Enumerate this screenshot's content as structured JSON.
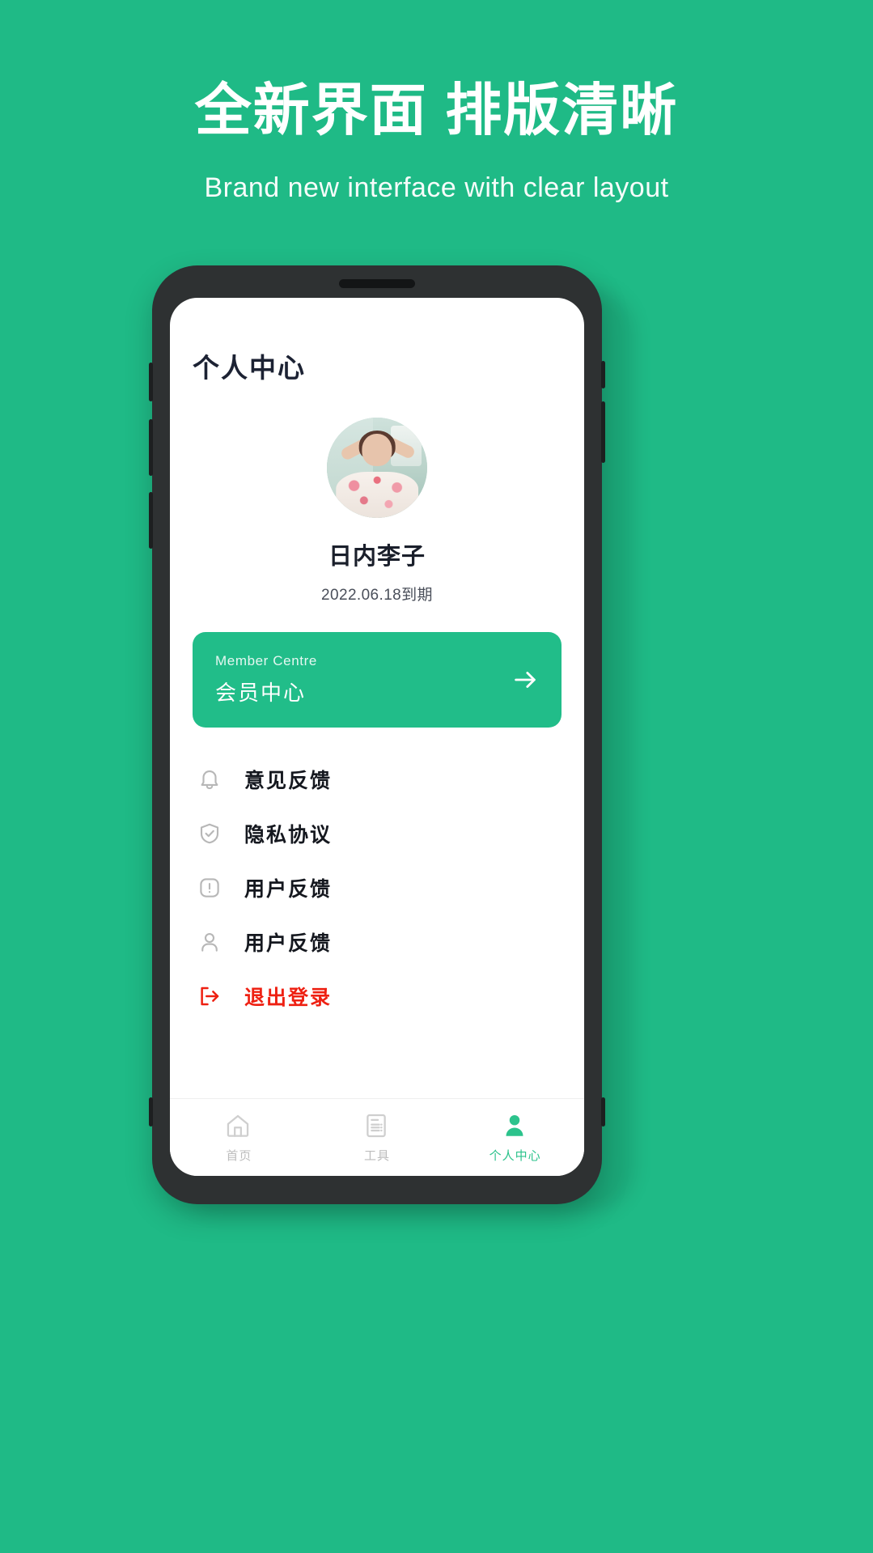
{
  "promo": {
    "headline": "全新界面 排版清晰",
    "subhead": "Brand new interface with clear layout",
    "background_color": "#1FBA86"
  },
  "phone": {
    "frame_color": "#2e3132",
    "screen_background": "#ffffff"
  },
  "app": {
    "page_title": "个人中心",
    "accent_color": "#21bd89",
    "danger_color": "#ee2012",
    "profile": {
      "avatar_name": "user-avatar-photo",
      "name": "日内李子",
      "expiry": "2022.06.18到期"
    },
    "member_card": {
      "subtitle_en": "Member Centre",
      "title_cn": "会员中心",
      "arrow_icon": "arrow-right-icon",
      "background_color": "#21bd89"
    },
    "menu": [
      {
        "icon": "bell-icon",
        "label": "意见反馈",
        "color": "#15181f"
      },
      {
        "icon": "shield-check-icon",
        "label": "隐私协议",
        "color": "#15181f"
      },
      {
        "icon": "alert-square-icon",
        "label": "用户反馈",
        "color": "#15181f"
      },
      {
        "icon": "user-icon",
        "label": "用户反馈",
        "color": "#15181f"
      },
      {
        "icon": "logout-icon",
        "label": "退出登录",
        "color": "#ee2012"
      }
    ],
    "tabbar": [
      {
        "icon": "home-icon",
        "label": "首页",
        "active": false
      },
      {
        "icon": "document-icon",
        "label": "工具",
        "active": false
      },
      {
        "icon": "person-filled-icon",
        "label": "个人中心",
        "active": true
      }
    ]
  }
}
